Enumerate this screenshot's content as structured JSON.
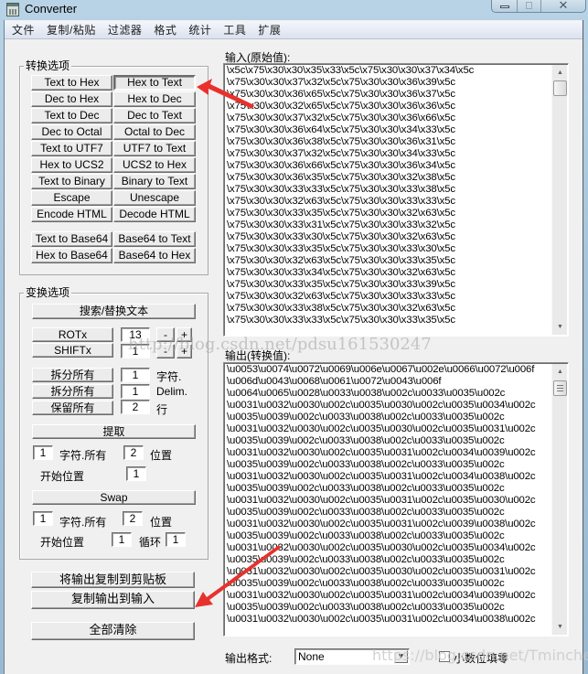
{
  "window": {
    "title": "Converter",
    "controls": {
      "minimize": "minimize",
      "maximize": "maximize",
      "close": "close"
    }
  },
  "menu": [
    "文件",
    "复制/粘贴",
    "过滤器",
    "格式",
    "统计",
    "工具",
    "扩展"
  ],
  "convert_options": {
    "label": "转换选项",
    "buttons": [
      [
        "Text to Hex",
        "Hex to Text"
      ],
      [
        "Dec to Hex",
        "Hex to Dec"
      ],
      [
        "Text to Dec",
        "Dec to Text"
      ],
      [
        "Dec to Octal",
        "Octal to Dec"
      ],
      [
        "Text to UTF7",
        "UTF7 to Text"
      ],
      [
        "Hex to UCS2",
        "UCS2 to Hex"
      ],
      [
        "Text to Binary",
        "Binary to Text"
      ],
      [
        "Escape",
        "Unescape"
      ],
      [
        "Encode HTML",
        "Decode HTML"
      ]
    ],
    "base64_buttons": [
      [
        "Text to Base64",
        "Base64 to Text"
      ],
      [
        "Hex to Base64",
        "Base64 to Hex"
      ]
    ],
    "pressed": "Hex to Text"
  },
  "transform_options": {
    "label": "变换选项",
    "search_replace": "搜索/替换文本",
    "rot": {
      "label": "ROTx",
      "value": "13",
      "minus": "-",
      "plus": "+"
    },
    "shift": {
      "label": "SHIFTx",
      "value": "1",
      "minus": "-",
      "plus": "+"
    },
    "split_chars": {
      "label": "拆分所有",
      "value": "1",
      "unit": "字符."
    },
    "split_delim": {
      "label": "拆分所有",
      "value": "1",
      "unit": "Delim."
    },
    "keep_lines": {
      "label": "保留所有",
      "value": "2",
      "unit": "行"
    },
    "extract": {
      "label": "提取",
      "chars_value": "1",
      "chars_label": "字符.所有",
      "pos_value": "2",
      "pos_label": "位置",
      "start_label": "开始位置",
      "start_value": "1"
    },
    "swap": {
      "label": "Swap",
      "chars_value": "1",
      "chars_label": "字符.所有",
      "pos_value": "2",
      "pos_label": "位置",
      "start_label": "开始位置",
      "start_value": "1",
      "loop_label": "循环",
      "loop_value": "1"
    }
  },
  "actions": {
    "copy_to_clipboard": "将输出复制到剪贴板",
    "copy_output_to_input": "复制输出到输入",
    "clear_all": "全部清除"
  },
  "input": {
    "label": "输入(原始值):",
    "lines": [
      "\\x5c\\x75\\x30\\x30\\x35\\x33\\x5c\\x75\\x30\\x30\\x37\\x34\\x5c",
      "\\x75\\x30\\x30\\x37\\x32\\x5c\\x75\\x30\\x30\\x36\\x39\\x5c",
      "\\x75\\x30\\x30\\x36\\x65\\x5c\\x75\\x30\\x30\\x36\\x37\\x5c",
      "\\x75\\x30\\x30\\x32\\x65\\x5c\\x75\\x30\\x30\\x36\\x36\\x5c",
      "\\x75\\x30\\x30\\x37\\x32\\x5c\\x75\\x30\\x30\\x36\\x66\\x5c",
      "\\x75\\x30\\x30\\x36\\x64\\x5c\\x75\\x30\\x30\\x34\\x33\\x5c",
      "\\x75\\x30\\x30\\x36\\x38\\x5c\\x75\\x30\\x30\\x36\\x31\\x5c",
      "\\x75\\x30\\x30\\x37\\x32\\x5c\\x75\\x30\\x30\\x34\\x33\\x5c",
      "\\x75\\x30\\x30\\x36\\x66\\x5c\\x75\\x30\\x30\\x36\\x34\\x5c",
      "\\x75\\x30\\x30\\x36\\x35\\x5c\\x75\\x30\\x30\\x32\\x38\\x5c",
      "\\x75\\x30\\x30\\x33\\x33\\x5c\\x75\\x30\\x30\\x33\\x38\\x5c",
      "\\x75\\x30\\x30\\x32\\x63\\x5c\\x75\\x30\\x30\\x33\\x33\\x5c",
      "\\x75\\x30\\x30\\x33\\x35\\x5c\\x75\\x30\\x30\\x32\\x63\\x5c",
      "\\x75\\x30\\x30\\x33\\x31\\x5c\\x75\\x30\\x30\\x33\\x32\\x5c",
      "\\x75\\x30\\x30\\x33\\x30\\x5c\\x75\\x30\\x30\\x32\\x63\\x5c",
      "\\x75\\x30\\x30\\x33\\x35\\x5c\\x75\\x30\\x30\\x33\\x30\\x5c",
      "\\x75\\x30\\x30\\x32\\x63\\x5c\\x75\\x30\\x30\\x33\\x35\\x5c",
      "\\x75\\x30\\x30\\x33\\x34\\x5c\\x75\\x30\\x30\\x32\\x63\\x5c",
      "\\x75\\x30\\x30\\x33\\x35\\x5c\\x75\\x30\\x30\\x33\\x39\\x5c",
      "\\x75\\x30\\x30\\x32\\x63\\x5c\\x75\\x30\\x30\\x33\\x33\\x5c",
      "\\x75\\x30\\x30\\x33\\x38\\x5c\\x75\\x30\\x30\\x32\\x63\\x5c",
      "\\x75\\x30\\x30\\x33\\x33\\x5c\\x75\\x30\\x30\\x33\\x35\\x5c"
    ]
  },
  "output": {
    "label": "输出(转换值):",
    "lines": [
      "\\u0053\\u0074\\u0072\\u0069\\u006e\\u0067\\u002e\\u0066\\u0072\\u006f",
      "\\u006d\\u0043\\u0068\\u0061\\u0072\\u0043\\u006f",
      "\\u0064\\u0065\\u0028\\u0033\\u0038\\u002c\\u0033\\u0035\\u002c",
      "\\u0031\\u0032\\u0030\\u002c\\u0035\\u0030\\u002c\\u0035\\u0034\\u002c",
      "\\u0035\\u0039\\u002c\\u0033\\u0038\\u002c\\u0033\\u0035\\u002c",
      "\\u0031\\u0032\\u0030\\u002c\\u0035\\u0030\\u002c\\u0035\\u0031\\u002c",
      "\\u0035\\u0039\\u002c\\u0033\\u0038\\u002c\\u0033\\u0035\\u002c",
      "\\u0031\\u0032\\u0030\\u002c\\u0035\\u0031\\u002c\\u0034\\u0039\\u002c",
      "\\u0035\\u0039\\u002c\\u0033\\u0038\\u002c\\u0033\\u0035\\u002c",
      "\\u0031\\u0032\\u0030\\u002c\\u0035\\u0031\\u002c\\u0034\\u0038\\u002c",
      "\\u0035\\u0039\\u002c\\u0033\\u0038\\u002c\\u0033\\u0035\\u002c",
      "\\u0031\\u0032\\u0030\\u002c\\u0035\\u0031\\u002c\\u0035\\u0030\\u002c",
      "\\u0035\\u0039\\u002c\\u0033\\u0038\\u002c\\u0033\\u0035\\u002c",
      "\\u0031\\u0032\\u0030\\u002c\\u0035\\u0031\\u002c\\u0039\\u0038\\u002c",
      "\\u0035\\u0039\\u002c\\u0033\\u0038\\u002c\\u0033\\u0035\\u002c",
      "\\u0031\\u0032\\u0030\\u002c\\u0035\\u0030\\u002c\\u0035\\u0034\\u002c",
      "\\u0035\\u0039\\u002c\\u0033\\u0038\\u002c\\u0033\\u0035\\u002c",
      "\\u0031\\u0032\\u0030\\u002c\\u0035\\u0030\\u002c\\u0035\\u0031\\u002c",
      "\\u0035\\u0039\\u002c\\u0033\\u0038\\u002c\\u0033\\u0035\\u002c",
      "\\u0031\\u0032\\u0030\\u002c\\u0035\\u0031\\u002c\\u0034\\u0039\\u002c",
      "\\u0035\\u0039\\u002c\\u0033\\u0038\\u002c\\u0033\\u0035\\u002c",
      "\\u0031\\u0032\\u0030\\u002c\\u0035\\u0031\\u002c\\u0034\\u0038\\u002c"
    ]
  },
  "footer": {
    "format_label": "输出格式:",
    "format_value": "None",
    "decimal_pad_label": "小数位填零",
    "decimal_pad_checked": false
  },
  "watermarks": {
    "middle": "http://blog.csdn.net/pdsu161530247",
    "bottom": "https://blog.csdn.net/Tmincherry"
  },
  "annotation_color": "#e8312d"
}
